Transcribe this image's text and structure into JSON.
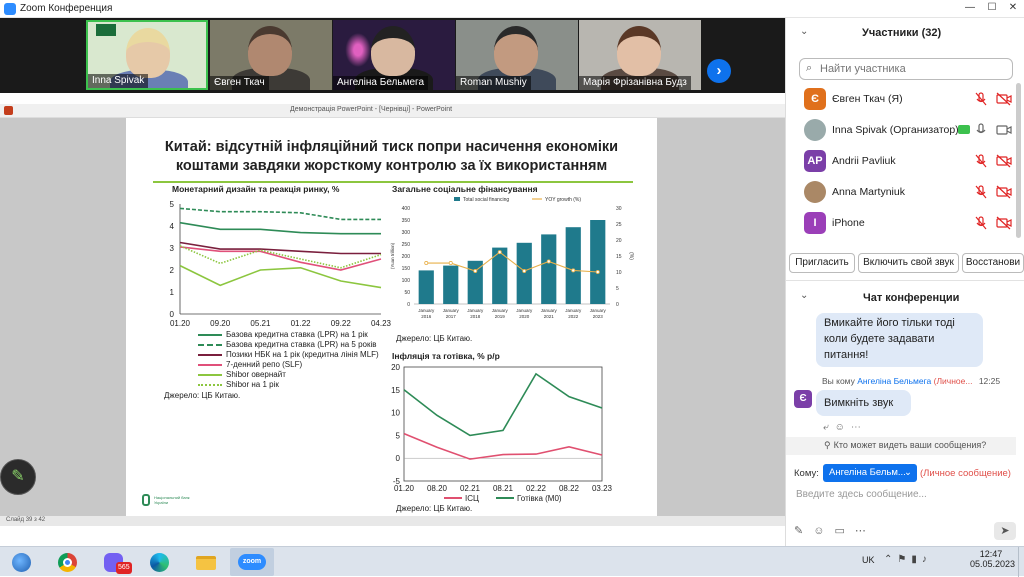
{
  "window": {
    "title": "Zoom Конференция",
    "app_icon": "zoom-icon",
    "minimize": "—",
    "maximize": "☐",
    "close": "✕"
  },
  "video_strip": {
    "tiles": [
      {
        "name": "Inna Spivak",
        "active_speaker": true
      },
      {
        "name": "Євген Ткач"
      },
      {
        "name": "Ангеліна Бельмега"
      },
      {
        "name": "Roman Mushiy"
      },
      {
        "name": "Марія Фрізанівна Будз"
      }
    ],
    "next_icon": "chevron-right-icon"
  },
  "ppt": {
    "window_title": "Демонстрація PowerPoint - [Чернівці] - PowerPoint",
    "status_left": "Слайд 39 з 42"
  },
  "slide": {
    "title": "Китай: відсутній інфляційний тиск попри насичення економіки коштами завдяки жорсткому контролю за їх використанням",
    "left_chart_title": "Монетарний дизайн та реакція ринку, %",
    "left_source": "Джерело: ЦБ Китаю.",
    "top_right_title": "Загальне соціальне фінансування",
    "top_right_source": "Джерело: ЦБ Китаю.",
    "bottom_right_title": "Інфляція та готівка, % р/р",
    "bottom_right_source": "Джерело: ЦБ Китаю.",
    "logo_text": "Національний банк України"
  },
  "chart_data": [
    {
      "type": "line",
      "title": "Монетарний дизайн та реакція ринку, %",
      "x": [
        "01.20",
        "09.20",
        "05.21",
        "01.22",
        "09.22",
        "04.23"
      ],
      "ylim": [
        0,
        5
      ],
      "yticks": [
        "0",
        "1",
        "2",
        "3",
        "4",
        "5"
      ],
      "series": [
        {
          "name": "Базова кредитна ставка (LPR) на 1 рік",
          "color": "#2e8b57",
          "style": "solid",
          "values": [
            4.15,
            3.85,
            3.85,
            3.7,
            3.65,
            3.65
          ]
        },
        {
          "name": "Базова кредитна ставка (LPR) на 5 років",
          "color": "#2e8b57",
          "style": "dashed",
          "values": [
            4.8,
            4.65,
            4.65,
            4.6,
            4.3,
            4.3
          ]
        },
        {
          "name": "Позики НБК на 1 рік (кредитна лінія MLF)",
          "color": "#7a1f3d",
          "style": "solid",
          "values": [
            3.25,
            2.95,
            2.95,
            2.85,
            2.75,
            2.75
          ]
        },
        {
          "name": "7-денний репо (SLF)",
          "color": "#e0507a",
          "style": "solid",
          "values": [
            3.05,
            2.85,
            2.85,
            2.35,
            2.0,
            2.5
          ]
        },
        {
          "name": "Shibor овернайт",
          "color": "#8cc63f",
          "style": "solid",
          "values": [
            2.2,
            1.3,
            2.0,
            2.1,
            1.5,
            1.2
          ]
        },
        {
          "name": "Shibor на 1 рік",
          "color": "#8cc63f",
          "style": "dotted",
          "values": [
            3.1,
            2.3,
            2.9,
            2.5,
            2.1,
            2.7
          ]
        }
      ]
    },
    {
      "type": "bar",
      "title": "Загальне соціальне фінансування",
      "categories": [
        "January 2016",
        "January 2017",
        "January 2018",
        "January 2019",
        "January 2020",
        "January 2021",
        "January 2022",
        "January 2023"
      ],
      "ylabel": "(Yuan trillion)",
      "y2label": "(%)",
      "ylim": [
        0,
        400
      ],
      "y2lim": [
        0,
        30
      ],
      "yticks": [
        "0",
        "50",
        "100",
        "150",
        "200",
        "250",
        "300",
        "350",
        "400"
      ],
      "y2ticks": [
        "0",
        "5",
        "10",
        "15",
        "20",
        "25",
        "30"
      ],
      "series": [
        {
          "name": "Total social financing",
          "color": "#1f7a8c",
          "values": [
            140,
            160,
            180,
            235,
            255,
            290,
            320,
            350
          ]
        },
        {
          "name": "YOY growth (%)",
          "color": "#e8b04a",
          "values": [
            12.8,
            12.8,
            10.3,
            16.2,
            10.3,
            13.3,
            10.5,
            10.0
          ]
        }
      ]
    },
    {
      "type": "line",
      "title": "Інфляція та готівка, % р/р",
      "x": [
        "01.20",
        "08.20",
        "02.21",
        "08.21",
        "02.22",
        "08.22",
        "03.23"
      ],
      "ylim": [
        -5,
        20
      ],
      "yticks": [
        "-5",
        "0",
        "5",
        "10",
        "15",
        "20"
      ],
      "series": [
        {
          "name": "ІСЦ",
          "color": "#e05070",
          "values": [
            5.4,
            2.4,
            -0.2,
            0.8,
            0.9,
            2.5,
            0.7
          ]
        },
        {
          "name": "Готівка (М0)",
          "color": "#2e8b57",
          "values": [
            15.0,
            9.4,
            5.0,
            6.1,
            18.5,
            13.5,
            11.0
          ]
        }
      ]
    }
  ],
  "panel": {
    "participants_title": "Участники (32)",
    "search_placeholder": "Найти участника",
    "participants": [
      {
        "name": "Євген Ткач (Я)",
        "avatar": "Є",
        "color": "#e0701c"
      },
      {
        "name": "Inna Spivak (Организатор)",
        "avatar": "",
        "color": "#9aa"
      },
      {
        "name": "Andrii Pavliuk",
        "avatar": "AP",
        "color": "#7b3fa8"
      },
      {
        "name": "Anna Martyniuk",
        "avatar": "",
        "color": "#a86"
      },
      {
        "name": "iPhone",
        "avatar": "I",
        "color": "#9b3fb8"
      }
    ],
    "buttons": {
      "invite": "Пригласить",
      "unmute": "Включить свой звук",
      "restore": "Восстанови"
    },
    "chat_title": "Чат конференции",
    "messages": [
      {
        "text": "Вмикайте його тільки тоді коли будете задавати питання!"
      },
      {
        "meta_prefix": "Вы кому",
        "to": "Ангеліна Бельмега",
        "private": "(Личное...",
        "time": "12:25",
        "text": "Вимкніть звук",
        "avatar": "Є"
      }
    ],
    "who_sees": "Кто может видеть ваши сообщения?",
    "to_label": "Кому:",
    "to_value": "Ангеліна Бельм...",
    "to_private": "(Личное сообщение)",
    "input_placeholder": "Введите здесь сообщение..."
  },
  "taskbar": {
    "lang": "UK",
    "time": "12:47",
    "date": "05.05.2023",
    "viber_badge": "565",
    "apps": [
      "windows-start-icon",
      "chrome-icon",
      "viber-icon",
      "edge-icon",
      "file-explorer-icon",
      "zoom-icon"
    ]
  }
}
